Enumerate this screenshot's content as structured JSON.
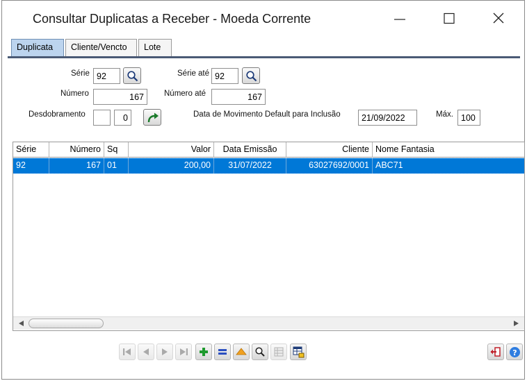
{
  "window": {
    "title": "Consultar Duplicatas a Receber - Moeda Corrente"
  },
  "tabs": [
    {
      "label": "Duplicata",
      "active": true
    },
    {
      "label": "Cliente/Vencto",
      "active": false
    },
    {
      "label": "Lote",
      "active": false
    }
  ],
  "form": {
    "serie_label": "Série",
    "serie_value": "92",
    "serie_ate_label": "Série até",
    "serie_ate_value": "92",
    "numero_label": "Número",
    "numero_value": "167",
    "numero_ate_label": "Número até",
    "numero_ate_value": "167",
    "desdobramento_label": "Desdobramento",
    "desdobramento_value": "",
    "desdobramento_seq": "0",
    "data_mov_label": "Data de Movimento Default para Inclusão",
    "data_mov_value": "21/09/2022",
    "max_label": "Máx.",
    "max_value": "100"
  },
  "grid": {
    "headers": [
      "Série",
      "Número",
      "Sq",
      "Valor",
      "Data Emissão",
      "Cliente",
      "Nome Fantasia"
    ],
    "rows": [
      {
        "serie": "92",
        "numero": "167",
        "sq": "01",
        "valor": "200,00",
        "data": "31/07/2022",
        "cliente": "63027692/0001",
        "fantasia": "ABC71"
      }
    ]
  },
  "colors": {
    "selection": "#0078d7",
    "tab_active": "#bcd4ee",
    "tab_line": "#4a5a75"
  }
}
